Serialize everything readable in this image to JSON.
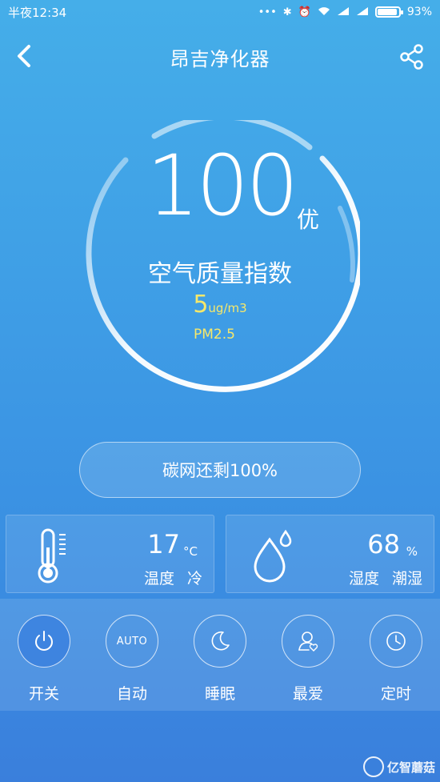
{
  "status_bar": {
    "time": "半夜12:34",
    "battery_percent": "93%",
    "battery_level": 0.93
  },
  "navbar": {
    "title": "昂吉净化器"
  },
  "air_quality": {
    "aqi": "100",
    "level": "优",
    "label": "空气质量指数",
    "pm_value": "5",
    "pm_unit": "ug/m3",
    "pm_label": "PM2.5"
  },
  "filter": {
    "text": "碳网还剩100%"
  },
  "temperature": {
    "value": "17",
    "unit": "°C",
    "label": "温度",
    "status": "冷"
  },
  "humidity": {
    "value": "68",
    "unit": "%",
    "label": "湿度",
    "status": "潮湿"
  },
  "controls": [
    {
      "label": "开关",
      "icon": "power-icon"
    },
    {
      "label": "自动",
      "icon": "auto-icon",
      "text": "AUTO"
    },
    {
      "label": "睡眠",
      "icon": "moon-icon"
    },
    {
      "label": "最爱",
      "icon": "favorite-user-icon"
    },
    {
      "label": "定时",
      "icon": "clock-icon"
    }
  ],
  "watermark": {
    "text": "亿智蘑菇"
  },
  "colors": {
    "accent": "#3fa0e6",
    "pm_yellow": "#f7e86a"
  }
}
